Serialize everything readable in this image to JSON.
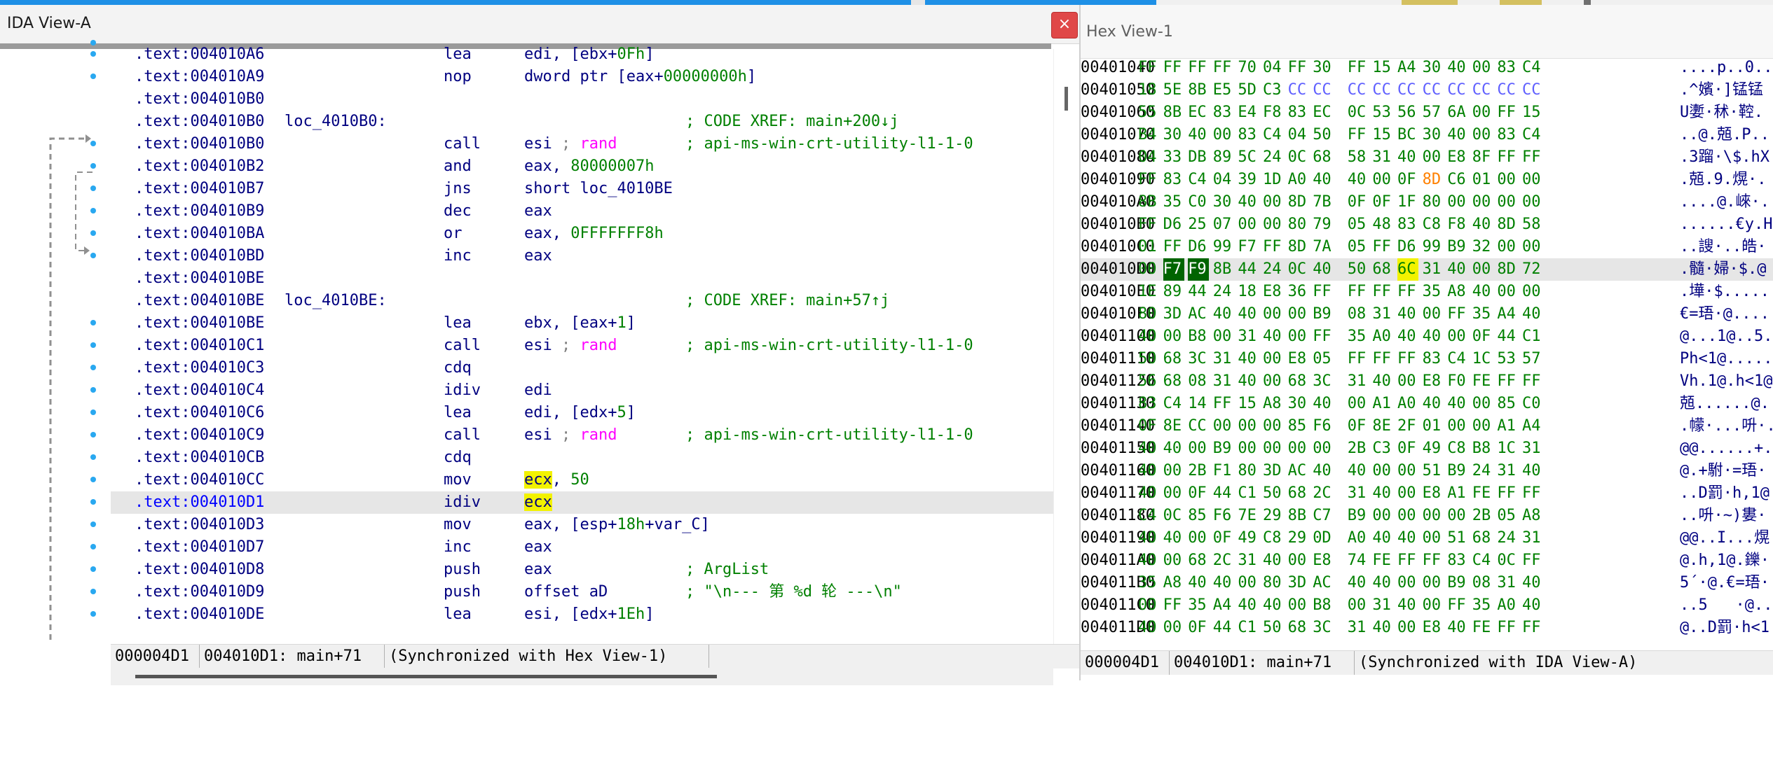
{
  "ida_view": {
    "title": "IDA View-A",
    "close_glyph": "×",
    "rows": [
      {
        "addr": ".text:004010A6",
        "mnemonic": "lea",
        "operands": [
          {
            "t": "edi, [ebx+"
          },
          {
            "t": "0Fh",
            "c": "num"
          },
          {
            "t": "]"
          }
        ]
      },
      {
        "addr": ".text:004010A9",
        "mnemonic": "nop",
        "operands": [
          {
            "t": "dword ptr [eax+"
          },
          {
            "t": "00000000h",
            "c": "num"
          },
          {
            "t": "]"
          }
        ]
      },
      {
        "addr": ".text:004010B0"
      },
      {
        "addr": ".text:004010B0",
        "label": "loc_4010B0:",
        "comment": "; CODE XREF: main+200↓j"
      },
      {
        "addr": ".text:004010B0",
        "mnemonic": "call",
        "operands": [
          {
            "t": "esi "
          },
          {
            "t": "; ",
            "c": "gry"
          },
          {
            "t": "rand",
            "c": "fn"
          }
        ],
        "comment": "; api-ms-win-crt-utility-l1-1-0",
        "comment_class": "gry"
      },
      {
        "addr": ".text:004010B2",
        "mnemonic": "and",
        "operands": [
          {
            "t": "eax, "
          },
          {
            "t": "80000007h",
            "c": "num"
          }
        ]
      },
      {
        "addr": ".text:004010B7",
        "mnemonic": "jns",
        "operands": [
          {
            "t": "short loc_4010BE"
          }
        ]
      },
      {
        "addr": ".text:004010B9",
        "mnemonic": "dec",
        "operands": [
          {
            "t": "eax"
          }
        ]
      },
      {
        "addr": ".text:004010BA",
        "mnemonic": "or",
        "operands": [
          {
            "t": "eax, "
          },
          {
            "t": "0FFFFFFF8h",
            "c": "num"
          }
        ]
      },
      {
        "addr": ".text:004010BD",
        "mnemonic": "inc",
        "operands": [
          {
            "t": "eax"
          }
        ]
      },
      {
        "addr": ".text:004010BE"
      },
      {
        "addr": ".text:004010BE",
        "label": "loc_4010BE:",
        "comment": "; CODE XREF: main+57↑j"
      },
      {
        "addr": ".text:004010BE",
        "mnemonic": "lea",
        "operands": [
          {
            "t": "ebx, [eax+"
          },
          {
            "t": "1",
            "c": "num"
          },
          {
            "t": "]"
          }
        ]
      },
      {
        "addr": ".text:004010C1",
        "mnemonic": "call",
        "operands": [
          {
            "t": "esi "
          },
          {
            "t": "; ",
            "c": "gry"
          },
          {
            "t": "rand",
            "c": "fn"
          }
        ],
        "comment": "; api-ms-win-crt-utility-l1-1-0",
        "comment_class": "gry"
      },
      {
        "addr": ".text:004010C3",
        "mnemonic": "cdq"
      },
      {
        "addr": ".text:004010C4",
        "mnemonic": "idiv",
        "operands": [
          {
            "t": "edi"
          }
        ]
      },
      {
        "addr": ".text:004010C6",
        "mnemonic": "lea",
        "operands": [
          {
            "t": "edi, [edx+"
          },
          {
            "t": "5",
            "c": "num"
          },
          {
            "t": "]"
          }
        ]
      },
      {
        "addr": ".text:004010C9",
        "mnemonic": "call",
        "operands": [
          {
            "t": "esi "
          },
          {
            "t": "; ",
            "c": "gry"
          },
          {
            "t": "rand",
            "c": "fn"
          }
        ],
        "comment": "; api-ms-win-crt-utility-l1-1-0",
        "comment_class": "gry"
      },
      {
        "addr": ".text:004010CB",
        "mnemonic": "cdq"
      },
      {
        "addr": ".text:004010CC",
        "mnemonic": "mov",
        "operands": [
          {
            "t": "ecx",
            "c": "hl"
          },
          {
            "t": ", "
          },
          {
            "t": "50",
            "c": "num"
          }
        ]
      },
      {
        "addr": ".text:004010D1",
        "mnemonic": "idiv",
        "operands": [
          {
            "t": "ecx",
            "c": "hl"
          }
        ],
        "current": true
      },
      {
        "addr": ".text:004010D3",
        "mnemonic": "mov",
        "operands": [
          {
            "t": "eax, [esp+"
          },
          {
            "t": "18h",
            "c": "num"
          },
          {
            "t": "+var_C]"
          }
        ]
      },
      {
        "addr": ".text:004010D7",
        "mnemonic": "inc",
        "operands": [
          {
            "t": "eax"
          }
        ]
      },
      {
        "addr": ".text:004010D8",
        "mnemonic": "push",
        "operands": [
          {
            "t": "eax"
          }
        ],
        "comment": "; ArgList"
      },
      {
        "addr": ".text:004010D9",
        "mnemonic": "push",
        "operands": [
          {
            "t": "offset aD"
          }
        ],
        "comment": "; \"\\n--- 第 %d 轮 ---\\n\"",
        "comment_class": "gry"
      },
      {
        "addr": ".text:004010DE",
        "mnemonic": "lea",
        "operands": [
          {
            "t": "esi, [edx+"
          },
          {
            "t": "1Eh",
            "c": "num"
          },
          {
            "t": "]"
          }
        ]
      }
    ],
    "status": {
      "offset": "000004D1",
      "location": "004010D1: main+71",
      "sync": "(Synchronized with Hex View-1)"
    }
  },
  "hex_view": {
    "title": "Hex View-1",
    "rows": [
      {
        "addr": "00401040",
        "bytes": [
          "FF",
          "FF",
          "FF",
          "FF",
          "70",
          "04",
          "FF",
          "30",
          "FF",
          "15",
          "A4",
          "30",
          "40",
          "00",
          "83",
          "C4"
        ],
        "ascii": "....p..0..."
      },
      {
        "addr": "00401050",
        "bytes": [
          "18",
          "5E",
          "8B",
          "E5",
          "5D",
          "C3",
          "CC",
          "CC",
          "CC",
          "CC",
          "CC",
          "CC",
          "CC",
          "CC",
          "CC",
          "CC"
        ],
        "ascii": ".^嬪·]锰锰"
      },
      {
        "addr": "00401060",
        "bytes": [
          "55",
          "8B",
          "EC",
          "83",
          "E4",
          "F8",
          "83",
          "EC",
          "0C",
          "53",
          "56",
          "57",
          "6A",
          "00",
          "FF",
          "15"
        ],
        "ascii": "U嬱·秫·鞚."
      },
      {
        "addr": "00401070",
        "bytes": [
          "B4",
          "30",
          "40",
          "00",
          "83",
          "C4",
          "04",
          "50",
          "FF",
          "15",
          "BC",
          "30",
          "40",
          "00",
          "83",
          "C4"
        ],
        "ascii": "..@.兡.P.."
      },
      {
        "addr": "00401080",
        "bytes": [
          "04",
          "33",
          "DB",
          "89",
          "5C",
          "24",
          "0C",
          "68",
          "58",
          "31",
          "40",
          "00",
          "E8",
          "8F",
          "FF",
          "FF"
        ],
        "ascii": ".3蹓·\\$.hX"
      },
      {
        "addr": "00401090",
        "bytes": [
          "FF",
          "83",
          "C4",
          "04",
          "39",
          "1D",
          "A0",
          "40",
          "40",
          "00",
          "0F",
          "8D",
          "C6",
          "01",
          "00",
          "00"
        ],
        "ascii": ".兡.9.熀·."
      },
      {
        "addr": "004010A0",
        "bytes": [
          "8B",
          "35",
          "C0",
          "30",
          "40",
          "00",
          "8D",
          "7B",
          "0F",
          "0F",
          "1F",
          "80",
          "00",
          "00",
          "00",
          "00"
        ],
        "ascii": "....@.崍·."
      },
      {
        "addr": "004010B0",
        "bytes": [
          "FF",
          "D6",
          "25",
          "07",
          "00",
          "00",
          "80",
          "79",
          "05",
          "48",
          "83",
          "C8",
          "F8",
          "40",
          "8D",
          "58"
        ],
        "ascii": "......€y.H"
      },
      {
        "addr": "004010C0",
        "bytes": [
          "01",
          "FF",
          "D6",
          "99",
          "F7",
          "FF",
          "8D",
          "7A",
          "05",
          "FF",
          "D6",
          "99",
          "B9",
          "32",
          "00",
          "00"
        ],
        "ascii": "..謏·..皓·"
      },
      {
        "addr": "004010D0",
        "bytes": [
          "00",
          "F7",
          "F9",
          "8B",
          "44",
          "24",
          "0C",
          "40",
          "50",
          "68",
          "6C",
          "31",
          "40",
          "00",
          "8D",
          "72"
        ],
        "ascii": ".髓·婦·$.@",
        "current": true
      },
      {
        "addr": "004010E0",
        "bytes": [
          "1E",
          "89",
          "44",
          "24",
          "18",
          "E8",
          "36",
          "FF",
          "FF",
          "FF",
          "FF",
          "35",
          "A8",
          "40",
          "00",
          "00"
        ],
        "ascii": ".墷·$....."
      },
      {
        "addr": "004010F0",
        "bytes": [
          "80",
          "3D",
          "AC",
          "40",
          "40",
          "00",
          "00",
          "B9",
          "08",
          "31",
          "40",
          "00",
          "FF",
          "35",
          "A4",
          "40"
        ],
        "ascii": "€=珸·@....."
      },
      {
        "addr": "00401100",
        "bytes": [
          "40",
          "00",
          "B8",
          "00",
          "31",
          "40",
          "00",
          "FF",
          "35",
          "A0",
          "40",
          "40",
          "00",
          "0F",
          "44",
          "C1"
        ],
        "ascii": "@...1@..5."
      },
      {
        "addr": "00401110",
        "bytes": [
          "50",
          "68",
          "3C",
          "31",
          "40",
          "00",
          "E8",
          "05",
          "FF",
          "FF",
          "FF",
          "83",
          "C4",
          "1C",
          "53",
          "57"
        ],
        "ascii": "Ph<1@....."
      },
      {
        "addr": "00401120",
        "bytes": [
          "56",
          "68",
          "08",
          "31",
          "40",
          "00",
          "68",
          "3C",
          "31",
          "40",
          "00",
          "E8",
          "F0",
          "FE",
          "FF",
          "FF"
        ],
        "ascii": "Vh.1@.h<1@"
      },
      {
        "addr": "00401130",
        "bytes": [
          "83",
          "C4",
          "14",
          "FF",
          "15",
          "A8",
          "30",
          "40",
          "00",
          "A1",
          "A0",
          "40",
          "40",
          "00",
          "85",
          "C0"
        ],
        "ascii": "兡......@."
      },
      {
        "addr": "00401140",
        "bytes": [
          "0F",
          "8E",
          "CC",
          "00",
          "00",
          "00",
          "85",
          "F6",
          "0F",
          "8E",
          "2F",
          "01",
          "00",
          "00",
          "A1",
          "A4"
        ],
        "ascii": ".幪·...呏·."
      },
      {
        "addr": "00401150",
        "bytes": [
          "40",
          "40",
          "00",
          "B9",
          "00",
          "00",
          "00",
          "00",
          "2B",
          "C3",
          "0F",
          "49",
          "C8",
          "B8",
          "1C",
          "31"
        ],
        "ascii": "@@......+."
      },
      {
        "addr": "00401160",
        "bytes": [
          "40",
          "00",
          "2B",
          "F1",
          "80",
          "3D",
          "AC",
          "40",
          "40",
          "00",
          "00",
          "51",
          "B9",
          "24",
          "31",
          "40"
        ],
        "ascii": "@.+駙·=珸·"
      },
      {
        "addr": "00401170",
        "bytes": [
          "40",
          "00",
          "0F",
          "44",
          "C1",
          "50",
          "68",
          "2C",
          "31",
          "40",
          "00",
          "E8",
          "A1",
          "FE",
          "FF",
          "FF"
        ],
        "ascii": "..D罰·h,1@"
      },
      {
        "addr": "00401180",
        "bytes": [
          "C4",
          "0C",
          "85",
          "F6",
          "7E",
          "29",
          "8B",
          "C7",
          "B9",
          "00",
          "00",
          "00",
          "00",
          "2B",
          "05",
          "A8"
        ],
        "ascii": "..呏·~)婁·"
      },
      {
        "addr": "00401190",
        "bytes": [
          "40",
          "40",
          "00",
          "0F",
          "49",
          "C8",
          "29",
          "0D",
          "A0",
          "40",
          "40",
          "00",
          "51",
          "68",
          "24",
          "31"
        ],
        "ascii": "@@..I...熀"
      },
      {
        "addr": "004011A0",
        "bytes": [
          "40",
          "00",
          "68",
          "2C",
          "31",
          "40",
          "00",
          "E8",
          "74",
          "FE",
          "FF",
          "FF",
          "83",
          "C4",
          "0C",
          "FF"
        ],
        "ascii": "@.h,1@.鑠·"
      },
      {
        "addr": "004011B0",
        "bytes": [
          "35",
          "A8",
          "40",
          "40",
          "00",
          "80",
          "3D",
          "AC",
          "40",
          "40",
          "00",
          "00",
          "B9",
          "08",
          "31",
          "40"
        ],
        "ascii": "5´·@.€=珸·"
      },
      {
        "addr": "004011C0",
        "bytes": [
          "00",
          "FF",
          "35",
          "A4",
          "40",
          "40",
          "00",
          "B8",
          "00",
          "31",
          "40",
          "00",
          "FF",
          "35",
          "A0",
          "40"
        ],
        "ascii": "..5   ·@.."
      },
      {
        "addr": "004011D0",
        "bytes": [
          "40",
          "00",
          "0F",
          "44",
          "C1",
          "50",
          "68",
          "3C",
          "31",
          "40",
          "00",
          "E8",
          "40",
          "FE",
          "FF",
          "FF"
        ],
        "ascii": "@..D罰·h<1"
      }
    ],
    "byte_styles": {
      "1": {
        "6": "cc",
        "7": "cc",
        "8": "cc",
        "9": "cc",
        "10": "cc",
        "11": "cc",
        "12": "cc",
        "13": "cc",
        "14": "cc",
        "15": "cc"
      },
      "5": {
        "11": "org"
      },
      "9": {
        "1": "sel",
        "2": "sel",
        "10": "yhl"
      }
    },
    "status": {
      "offset": "000004D1",
      "location": "004010D1: main+71",
      "sync": "(Synchronized with IDA View-A)"
    }
  },
  "colors": {
    "accent_blue": "#29a8f0",
    "close_red": "#e04848",
    "selected_byte": "#006400",
    "highlight": "#f2f200"
  }
}
